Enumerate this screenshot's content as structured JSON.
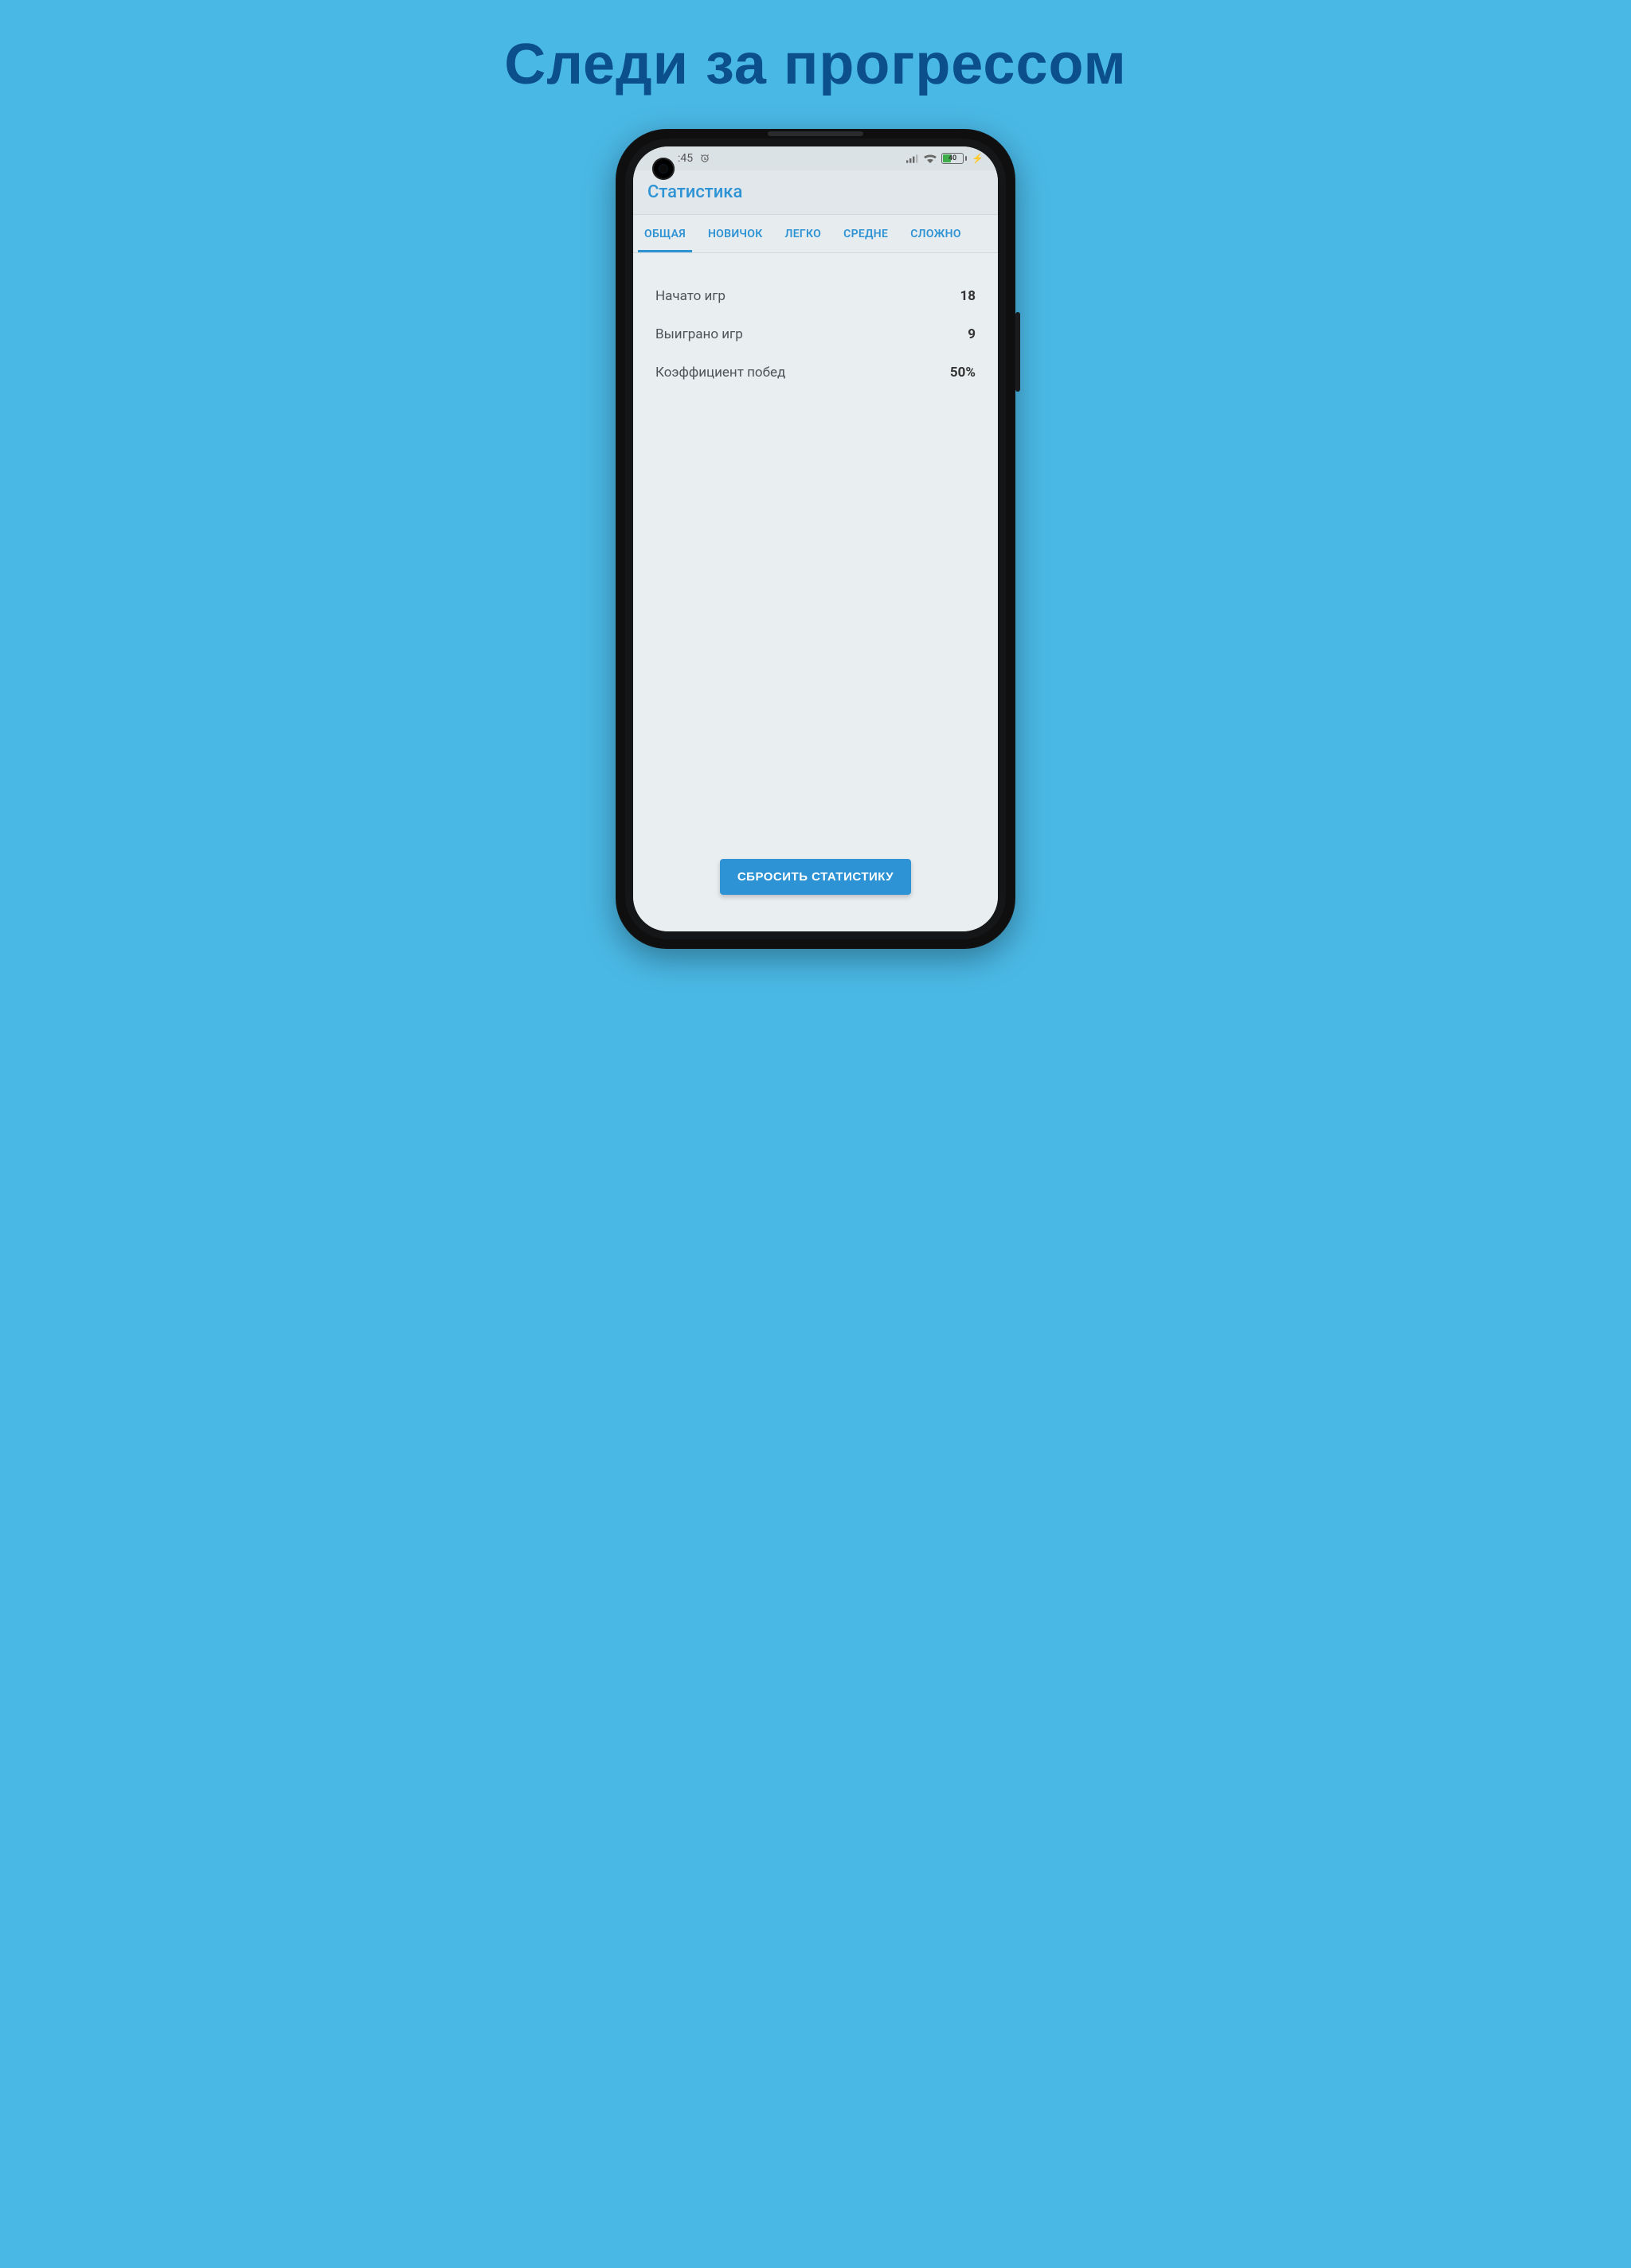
{
  "headline": "Следи за прогрессом",
  "status_bar": {
    "time": ":45",
    "battery_pct": "40"
  },
  "app_bar": {
    "title": "Статистика"
  },
  "tabs": [
    {
      "label": "ОБЩАЯ",
      "active": true
    },
    {
      "label": "НОВИЧОК",
      "active": false
    },
    {
      "label": "ЛЕГКО",
      "active": false
    },
    {
      "label": "СРЕДНЕ",
      "active": false
    },
    {
      "label": "СЛОЖНО",
      "active": false
    }
  ],
  "stats": [
    {
      "label": "Начато игр",
      "value": "18"
    },
    {
      "label": "Выиграно игр",
      "value": "9"
    },
    {
      "label": "Коэффициент побед",
      "value": "50%"
    }
  ],
  "reset_button": "СБРОСИТЬ СТАТИСТИКУ"
}
